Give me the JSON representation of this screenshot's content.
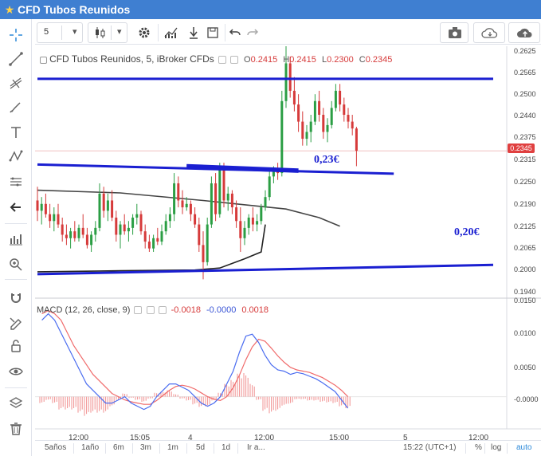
{
  "window": {
    "title": "CFD Tubos Reunidos"
  },
  "toolbar": {
    "interval": "5",
    "interval_arrow": "▾",
    "chart_type_arrow": "▾"
  },
  "legend": {
    "title": "CFD Tubos Reunidos, 5, iBroker CFDs",
    "o_label": "O",
    "o_value": "0.2415",
    "h_label": "H",
    "h_value": "0.2415",
    "l_label": "L",
    "l_value": "0.2300",
    "c_label": "C",
    "c_value": "0.2345"
  },
  "macd": {
    "label": "MACD (12, 26, close, 9)",
    "v1": "-0.0018",
    "v2": "-0.0000",
    "v3": "0.0018"
  },
  "annotations": {
    "a1": "0,23€",
    "a2": "0,20€"
  },
  "price_axis": {
    "labels": [
      "0.2625",
      "0.2565",
      "0.2500",
      "0.2440",
      "0.2375",
      "0.2315",
      "0.2250",
      "0.2190",
      "0.2125",
      "0.2065",
      "0.2000",
      "0.1940"
    ],
    "current": "0.2345"
  },
  "macd_axis": {
    "labels": [
      "0.0150",
      "0.0100",
      "0.0050",
      "0.0000"
    ],
    "neg_label": "-0.0000"
  },
  "time_axis": {
    "labels": [
      "12:00",
      "15:05",
      "4",
      "12:00",
      "15:00",
      "5",
      "12:00"
    ]
  },
  "bottom": {
    "ranges": [
      "5años",
      "1año",
      "6m",
      "3m",
      "1m",
      "5d",
      "1d",
      "Ir a..."
    ],
    "clock": "15:22 (UTC+1)",
    "percent": "%",
    "log": "log",
    "auto": "auto"
  },
  "colors": {
    "up": "#2b9e44",
    "down": "#d63a3a",
    "annotation": "#1a1fd1",
    "macd_line": "#4a6cf0",
    "signal_line": "#f06a6a",
    "titlebar": "#3f7fd1"
  },
  "chart_data": {
    "type": "candlestick",
    "interval": "5",
    "y_range": [
      0.1915,
      0.265
    ],
    "x_labels": [
      "12:00",
      "15:05",
      "4",
      "12:00",
      "15:00",
      "5",
      "12:00"
    ],
    "candles": [
      [
        0.22,
        0.224,
        0.214,
        0.217
      ],
      [
        0.217,
        0.221,
        0.213,
        0.219
      ],
      [
        0.219,
        0.222,
        0.215,
        0.216
      ],
      [
        0.216,
        0.219,
        0.212,
        0.214
      ],
      [
        0.214,
        0.218,
        0.211,
        0.216
      ],
      [
        0.216,
        0.219,
        0.212,
        0.213
      ],
      [
        0.213,
        0.215,
        0.208,
        0.21
      ],
      [
        0.21,
        0.213,
        0.207,
        0.209
      ],
      [
        0.209,
        0.212,
        0.206,
        0.211
      ],
      [
        0.211,
        0.214,
        0.208,
        0.209
      ],
      [
        0.209,
        0.213,
        0.208,
        0.212
      ],
      [
        0.212,
        0.216,
        0.209,
        0.21
      ],
      [
        0.21,
        0.212,
        0.206,
        0.207
      ],
      [
        0.207,
        0.211,
        0.205,
        0.21
      ],
      [
        0.21,
        0.214,
        0.208,
        0.212
      ],
      [
        0.212,
        0.225,
        0.211,
        0.222
      ],
      [
        0.222,
        0.224,
        0.215,
        0.217
      ],
      [
        0.217,
        0.222,
        0.214,
        0.22
      ],
      [
        0.22,
        0.223,
        0.214,
        0.215
      ],
      [
        0.215,
        0.217,
        0.208,
        0.21
      ],
      [
        0.21,
        0.214,
        0.206,
        0.213
      ],
      [
        0.213,
        0.216,
        0.21,
        0.211
      ],
      [
        0.211,
        0.214,
        0.208,
        0.212
      ],
      [
        0.212,
        0.216,
        0.21,
        0.215
      ],
      [
        0.215,
        0.219,
        0.213,
        0.216
      ],
      [
        0.216,
        0.217,
        0.21,
        0.211
      ],
      [
        0.211,
        0.213,
        0.206,
        0.208
      ],
      [
        0.208,
        0.21,
        0.205,
        0.206
      ],
      [
        0.206,
        0.21,
        0.205,
        0.209
      ],
      [
        0.209,
        0.212,
        0.207,
        0.208
      ],
      [
        0.208,
        0.213,
        0.207,
        0.211
      ],
      [
        0.211,
        0.216,
        0.21,
        0.214
      ],
      [
        0.214,
        0.218,
        0.212,
        0.216
      ],
      [
        0.216,
        0.228,
        0.214,
        0.225
      ],
      [
        0.225,
        0.227,
        0.218,
        0.22
      ],
      [
        0.22,
        0.223,
        0.216,
        0.218
      ],
      [
        0.218,
        0.221,
        0.217,
        0.219
      ],
      [
        0.219,
        0.22,
        0.214,
        0.216
      ],
      [
        0.216,
        0.218,
        0.212,
        0.213
      ],
      [
        0.213,
        0.215,
        0.205,
        0.207
      ],
      [
        0.207,
        0.211,
        0.197,
        0.202
      ],
      [
        0.202,
        0.215,
        0.201,
        0.213
      ],
      [
        0.213,
        0.227,
        0.212,
        0.225
      ],
      [
        0.225,
        0.228,
        0.214,
        0.216
      ],
      [
        0.216,
        0.231,
        0.215,
        0.229
      ],
      [
        0.229,
        0.231,
        0.218,
        0.22
      ],
      [
        0.22,
        0.224,
        0.217,
        0.222
      ],
      [
        0.222,
        0.223,
        0.216,
        0.218
      ],
      [
        0.218,
        0.22,
        0.212,
        0.214
      ],
      [
        0.214,
        0.218,
        0.205,
        0.209
      ],
      [
        0.209,
        0.214,
        0.207,
        0.212
      ],
      [
        0.212,
        0.216,
        0.21,
        0.215
      ],
      [
        0.215,
        0.218,
        0.211,
        0.213
      ],
      [
        0.213,
        0.216,
        0.211,
        0.214
      ],
      [
        0.214,
        0.219,
        0.213,
        0.218
      ],
      [
        0.218,
        0.223,
        0.217,
        0.221
      ],
      [
        0.221,
        0.229,
        0.22,
        0.227
      ],
      [
        0.227,
        0.23,
        0.225,
        0.229
      ],
      [
        0.229,
        0.231,
        0.226,
        0.228
      ],
      [
        0.228,
        0.252,
        0.227,
        0.249
      ],
      [
        0.249,
        0.265,
        0.247,
        0.26
      ],
      [
        0.26,
        0.262,
        0.25,
        0.252
      ],
      [
        0.252,
        0.256,
        0.246,
        0.248
      ],
      [
        0.248,
        0.251,
        0.24,
        0.243
      ],
      [
        0.243,
        0.246,
        0.236,
        0.238
      ],
      [
        0.238,
        0.242,
        0.236,
        0.24
      ],
      [
        0.24,
        0.245,
        0.237,
        0.243
      ],
      [
        0.243,
        0.251,
        0.242,
        0.249
      ],
      [
        0.249,
        0.252,
        0.243,
        0.245
      ],
      [
        0.245,
        0.247,
        0.238,
        0.24
      ],
      [
        0.24,
        0.244,
        0.237,
        0.242
      ],
      [
        0.242,
        0.249,
        0.241,
        0.247
      ],
      [
        0.247,
        0.254,
        0.246,
        0.252
      ],
      [
        0.252,
        0.254,
        0.246,
        0.248
      ],
      [
        0.248,
        0.25,
        0.243,
        0.245
      ],
      [
        0.245,
        0.247,
        0.241,
        0.243
      ],
      [
        0.243,
        0.245,
        0.239,
        0.241
      ],
      [
        0.241,
        0.2415,
        0.23,
        0.2345
      ]
    ],
    "trendlines": [
      {
        "color": "#1a1fd1",
        "points": [
          [
            0,
            0.2555
          ],
          [
            110,
            0.2555
          ]
        ]
      },
      {
        "color": "#1a1fd1",
        "points": [
          [
            0,
            0.2305
          ],
          [
            86,
            0.2278
          ]
        ]
      },
      {
        "color": "#1a1fd1",
        "points": [
          [
            36,
            0.2303
          ],
          [
            63,
            0.229
          ]
        ]
      },
      {
        "color": "#1a1fd1",
        "points": [
          [
            36,
            0.2297
          ],
          [
            63,
            0.2284
          ]
        ]
      },
      {
        "color": "#1a1fd1",
        "points": [
          [
            0,
            0.1985
          ],
          [
            110,
            0.2012
          ]
        ]
      }
    ],
    "moving_averages": [
      {
        "color": "#444444",
        "points": [
          [
            0,
            0.223
          ],
          [
            20,
            0.2222
          ],
          [
            40,
            0.22
          ],
          [
            52,
            0.2185
          ],
          [
            60,
            0.2175
          ],
          [
            68,
            0.215
          ],
          [
            73,
            0.2125
          ]
        ]
      },
      {
        "color": "#222222",
        "points": [
          [
            0,
            0.1992
          ],
          [
            20,
            0.1995
          ],
          [
            38,
            0.1997
          ],
          [
            44,
            0.2003
          ],
          [
            50,
            0.203
          ],
          [
            54,
            0.205
          ],
          [
            55,
            0.213
          ]
        ]
      }
    ],
    "macd": {
      "y_range": [
        -0.0048,
        0.0152
      ],
      "macd_line": [
        0.012,
        0.013,
        0.012,
        0.01,
        0.008,
        0.006,
        0.004,
        0.002,
        0.001,
        0.0,
        -0.001,
        -0.001,
        -0.0005,
        0.0,
        -0.001,
        -0.0015,
        -0.002,
        -0.0015,
        0.0,
        0.001,
        0.002,
        0.002,
        0.0015,
        0.001,
        0.0,
        -0.001,
        -0.0015,
        -0.001,
        0.0,
        0.002,
        0.004,
        0.007,
        0.0095,
        0.0098,
        0.0085,
        0.0065,
        0.005,
        0.0042,
        0.004,
        0.0035,
        0.0038,
        0.0036,
        0.0032,
        0.0028,
        0.0022,
        0.0015,
        0.0008,
        -0.0005,
        -0.0018
      ],
      "signal_line": [
        0.013,
        0.0135,
        0.013,
        0.012,
        0.01,
        0.008,
        0.0065,
        0.005,
        0.0035,
        0.0025,
        0.0015,
        0.0005,
        0.0,
        -0.0005,
        -0.0008,
        -0.001,
        -0.0012,
        -0.0012,
        -0.0006,
        0.0002,
        0.001,
        0.0016,
        0.0018,
        0.0016,
        0.0012,
        0.0006,
        0.0,
        -0.0004,
        -0.0006,
        0.0,
        0.0014,
        0.0034,
        0.0058,
        0.0078,
        0.009,
        0.0087,
        0.0076,
        0.0064,
        0.0054,
        0.0046,
        0.0042,
        0.004,
        0.0038,
        0.0034,
        0.003,
        0.0024,
        0.0018,
        0.001,
        0.0
      ],
      "histogram": [
        -0.001,
        -0.0005,
        -0.001,
        -0.002,
        -0.002,
        -0.002,
        -0.0025,
        -0.003,
        -0.0025,
        -0.0025,
        -0.0025,
        -0.0015,
        -0.0005,
        0.0005,
        -0.0002,
        -0.0005,
        -0.0008,
        -0.0003,
        0.0006,
        0.0008,
        0.001,
        0.0004,
        -0.0003,
        -0.0006,
        -0.0012,
        -0.0016,
        -0.0015,
        -0.0006,
        0.0006,
        0.002,
        0.0026,
        0.0036,
        0.0037,
        0.002,
        -0.0005,
        -0.0022,
        -0.0026,
        -0.0022,
        -0.0014,
        -0.0011,
        -0.0004,
        -0.0004,
        -0.0006,
        -0.0006,
        -0.0008,
        -0.0009,
        -0.001,
        -0.0015,
        -0.0018
      ]
    }
  }
}
